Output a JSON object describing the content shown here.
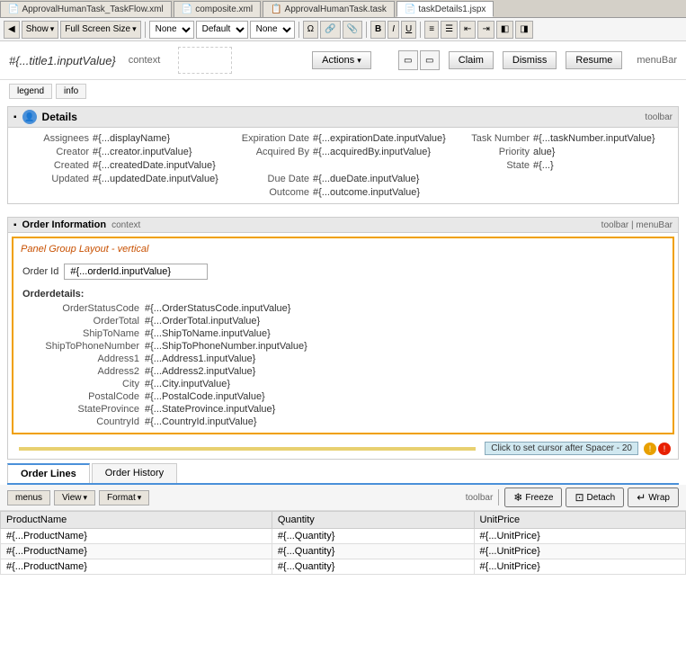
{
  "tabs": [
    {
      "id": "tab1",
      "label": "ApprovalHumanTask_TaskFlow.xml",
      "active": false
    },
    {
      "id": "tab2",
      "label": "composite.xml",
      "active": false
    },
    {
      "id": "tab3",
      "label": "ApprovalHumanTask.task",
      "active": false
    },
    {
      "id": "tab4",
      "label": "taskDetails1.jspx",
      "active": true
    }
  ],
  "main_toolbar": {
    "show_label": "Show",
    "full_screen_label": "Full Screen Size",
    "dropdown1": "None",
    "dropdown2": "Default",
    "dropdown3": "None",
    "bold": "B",
    "italic": "I",
    "underline": "U"
  },
  "header": {
    "title": "#{...title1.inputValue}",
    "context_label": "context",
    "actions_label": "Actions",
    "claim_label": "Claim",
    "dismiss_label": "Dismiss",
    "resume_label": "Resume",
    "menubar_label": "menuBar"
  },
  "legend_tabs": {
    "legend": "legend",
    "info": "info"
  },
  "details": {
    "title": "Details",
    "toolbar_label": "toolbar",
    "fields": {
      "assignees_label": "Assignees",
      "assignees_value": "#{...displayName}",
      "expiration_date_label": "Expiration Date",
      "expiration_date_value": "#{...expirationDate.inputValue}",
      "task_number_label": "Task Number",
      "task_number_value": "#{...taskNumber.inputValue}",
      "creator_label": "Creator",
      "creator_value": "#{...creator.inputValue}",
      "acquired_by_label": "Acquired By",
      "acquired_by_value": "#{...acquiredBy.inputValue}",
      "priority_label": "Priority",
      "priority_value": "alue}",
      "created_label": "Created",
      "created_value": "#{...createdDate.inputValue}",
      "state_label": "State",
      "state_value": "#{...}",
      "updated_label": "Updated",
      "updated_value": "#{...updatedDate.inputValue}",
      "due_date_label": "Due Date",
      "due_date_value": "#{...dueDate.inputValue}",
      "outcome_label": "Outcome",
      "outcome_value": "#{...outcome.inputValue}"
    }
  },
  "order_section": {
    "title": "Order Information",
    "context_label": "context",
    "toolbar_label": "toolbar",
    "menubar_label": "menuBar",
    "panel_group_label": "Panel Group Layout - vertical",
    "order_id_label": "Order Id",
    "order_id_value": "#{...orderId.inputValue}",
    "order_details_label": "Orderdetails:",
    "fields": [
      {
        "label": "OrderStatusCode",
        "value": "#{...OrderStatusCode.inputValue}"
      },
      {
        "label": "OrderTotal",
        "value": "#{...OrderTotal.inputValue}"
      },
      {
        "label": "ShipToName",
        "value": "#{...ShipToName.inputValue}"
      },
      {
        "label": "ShipToPhoneNumber",
        "value": "#{...ShipToPhoneNumber.inputValue}"
      },
      {
        "label": "Address1",
        "value": "#{...Address1.inputValue}"
      },
      {
        "label": "Address2",
        "value": "#{...Address2.inputValue}"
      },
      {
        "label": "City",
        "value": "#{...City.inputValue}"
      },
      {
        "label": "PostalCode",
        "value": "#{...PostalCode.inputValue}"
      },
      {
        "label": "StateProvince",
        "value": "#{...StateProvince.inputValue}"
      },
      {
        "label": "CountryId",
        "value": "#{...CountryId.inputValue}"
      }
    ]
  },
  "spacer": {
    "click_text": "Click to set cursor after Spacer - 20",
    "icon1_color": "#e8a000",
    "icon2_color": "#e82000"
  },
  "bottom_tabs": [
    {
      "label": "Order Lines",
      "active": true
    },
    {
      "label": "Order History",
      "active": false
    }
  ],
  "table_toolbar": {
    "menus_label": "menus",
    "view_label": "View",
    "format_label": "Format",
    "toolbar_label": "toolbar",
    "freeze_label": "Freeze",
    "detach_label": "Detach",
    "wrap_label": "Wrap"
  },
  "table": {
    "columns": [
      "ProductName",
      "Quantity",
      "UnitPrice"
    ],
    "rows": [
      [
        "#{...ProductName}",
        "#{...Quantity}",
        "#{...UnitPrice}"
      ],
      [
        "#{...ProductName}",
        "#{...Quantity}",
        "#{...UnitPrice}"
      ],
      [
        "#{...ProductName}",
        "#{...Quantity}",
        "#{...UnitPrice}"
      ]
    ]
  }
}
